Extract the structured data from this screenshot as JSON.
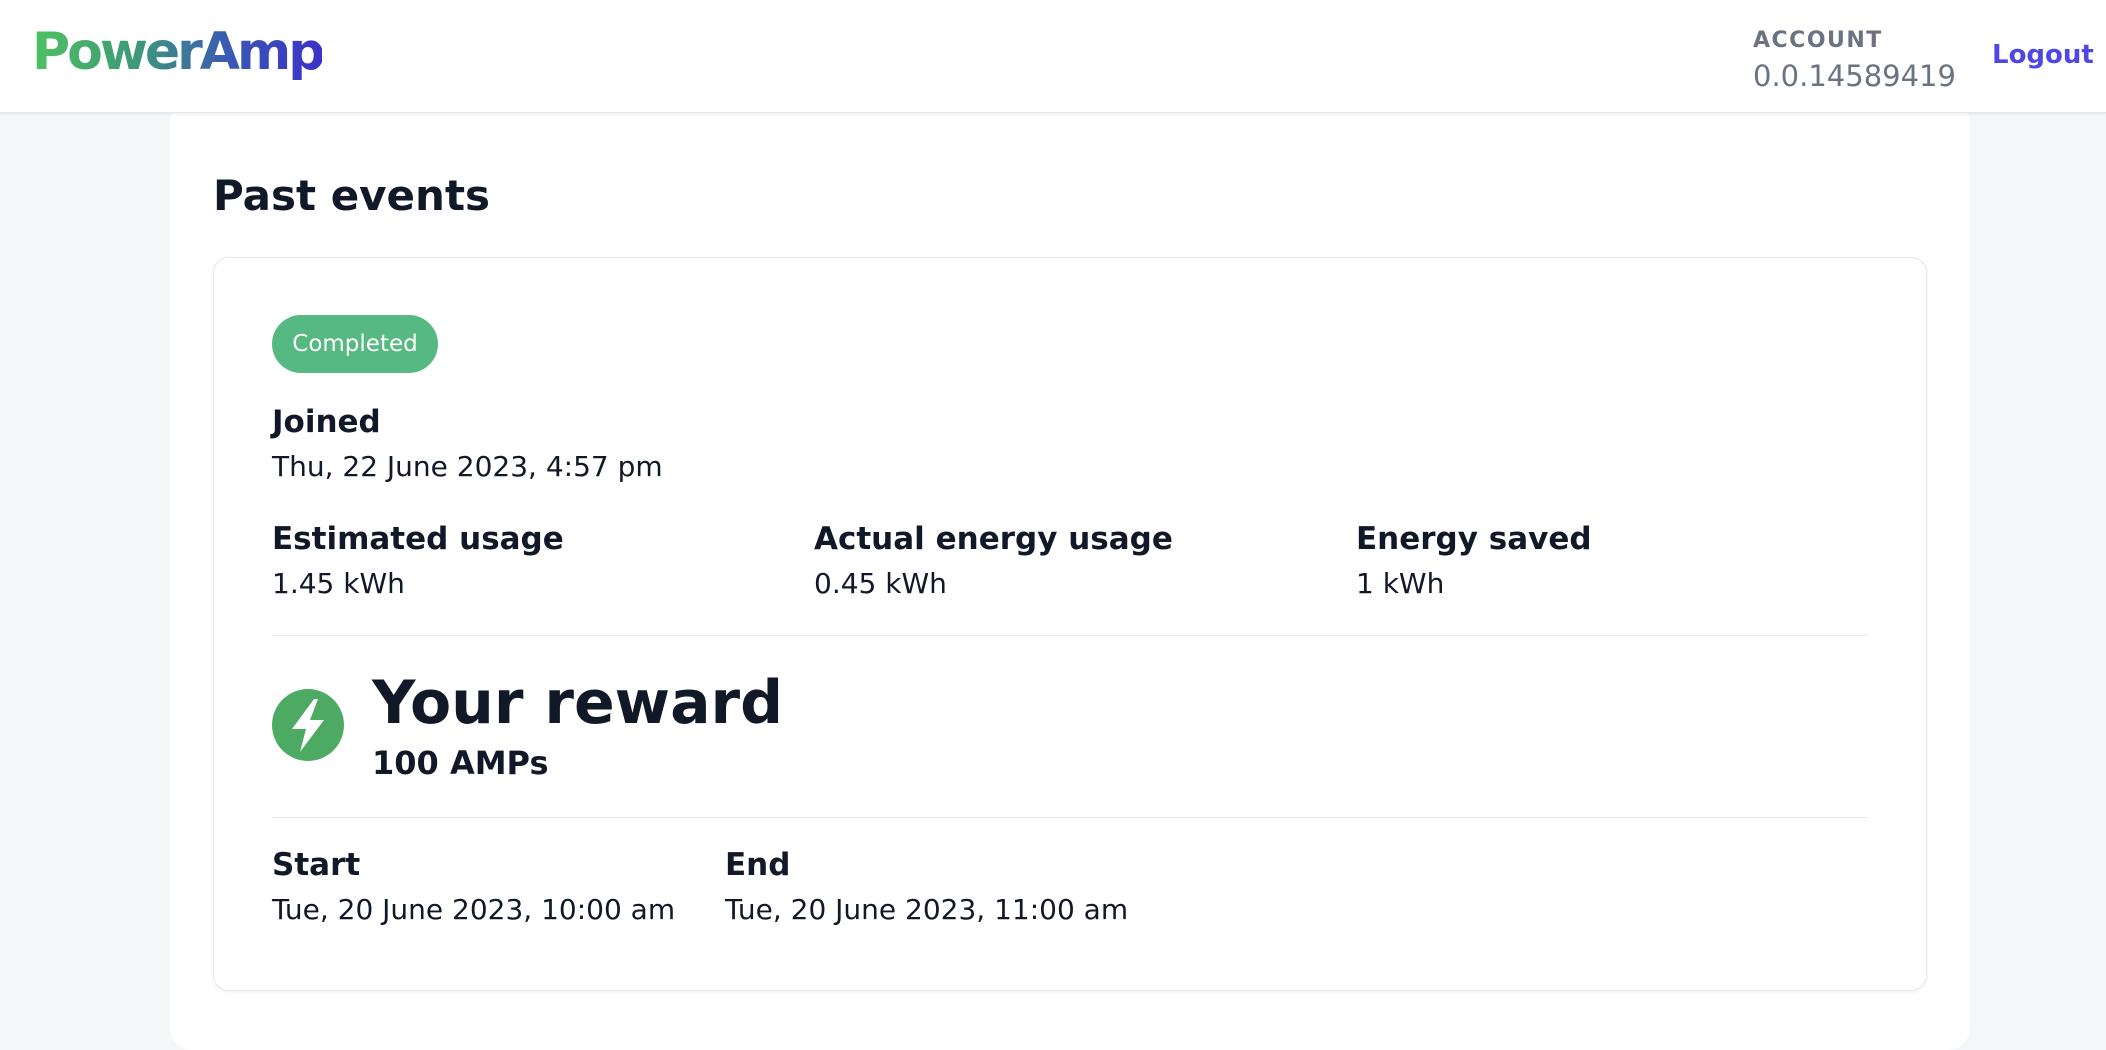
{
  "header": {
    "logo_text": "PowerAmp",
    "account_label": "ACCOUNT",
    "account_id": "0.0.14589419",
    "logout_label": "Logout"
  },
  "main": {
    "title": "Past events",
    "event": {
      "status": "Completed",
      "joined_label": "Joined",
      "joined_value": "Thu, 22 June 2023, 4:57 pm",
      "estimated_label": "Estimated usage",
      "estimated_value": "1.45 kWh",
      "actual_label": "Actual energy usage",
      "actual_value": "0.45 kWh",
      "saved_label": "Energy saved",
      "saved_value": "1 kWh",
      "reward_title": "Your reward",
      "reward_amount": "100 AMPs",
      "start_label": "Start",
      "start_value": "Tue, 20 June 2023, 10:00 am",
      "end_label": "End",
      "end_value": "Tue, 20 June 2023, 11:00 am"
    }
  },
  "colors": {
    "brand_green": "#4ec260",
    "brand_purple": "#3c32c8",
    "badge_green": "#56b982",
    "link": "#4f46e5"
  },
  "icons": {
    "reward": "lightning-bolt-icon"
  }
}
